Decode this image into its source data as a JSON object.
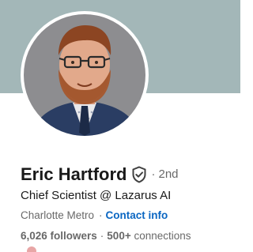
{
  "colors": {
    "banner": "#a3b7b8",
    "link": "#0a66c2",
    "avatar_background": "#8d8d90",
    "jacket": "#2a3d63"
  },
  "profile": {
    "name": "Eric Hartford",
    "verified_icon": "shield-check-icon",
    "degree_separator": "·",
    "degree": "2nd",
    "headline": "Chief Scientist @ Lazarus AI",
    "location": "Charlotte Metro",
    "location_separator": "·",
    "contact_link": "Contact info",
    "followers": "6,026 followers",
    "network_separator": "·",
    "connections_count": "500+",
    "connections_label": "connections"
  }
}
